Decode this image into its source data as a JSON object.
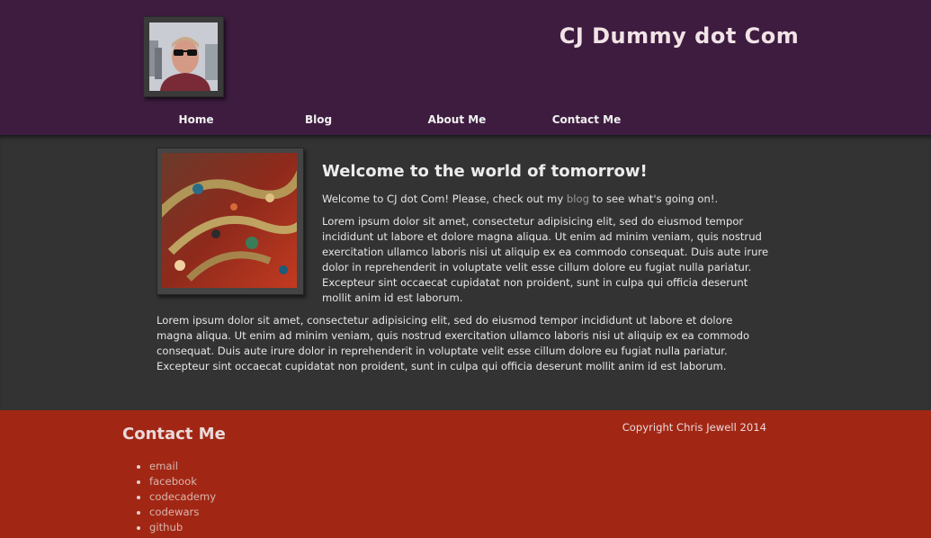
{
  "header": {
    "site_title": "CJ Dummy dot Com",
    "nav": [
      "Home",
      "Blog",
      "About Me",
      "Contact Me"
    ]
  },
  "main": {
    "heading": "Welcome to the world of tomorrow!",
    "intro_before": "Welcome to CJ dot Com! Please, check out my ",
    "intro_link": "blog",
    "intro_after": " to see what's going on!.",
    "paragraph_1": "Lorem ipsum dolor sit amet, consectetur adipisicing elit, sed do eiusmod tempor incididunt ut labore et dolore magna aliqua. Ut enim ad minim veniam, quis nostrud exercitation ullamco laboris nisi ut aliquip ex ea commodo consequat. Duis aute irure dolor in reprehenderit in voluptate velit esse cillum dolore eu fugiat nulla pariatur. Excepteur sint occaecat cupidatat non proident, sunt in culpa qui officia deserunt mollit anim id est laborum.",
    "paragraph_2": "Lorem ipsum dolor sit amet, consectetur adipisicing elit, sed do eiusmod tempor incididunt ut labore et dolore magna aliqua. Ut enim ad minim veniam, quis nostrud exercitation ullamco laboris nisi ut aliquip ex ea commodo consequat. Duis aute irure dolor in reprehenderit in voluptate velit esse cillum dolore eu fugiat nulla pariatur. Excepteur sint occaecat cupidatat non proident, sunt in culpa qui officia deserunt mollit anim id est laborum."
  },
  "footer": {
    "contact_heading": "Contact Me",
    "links": [
      "email",
      "facebook",
      "codecademy",
      "codewars",
      "github"
    ],
    "copyright": "Copyright Chris Jewell 2014"
  },
  "colors": {
    "header_bg": "#3e1c40",
    "main_bg": "#333333",
    "footer_bg": "#a12714"
  }
}
